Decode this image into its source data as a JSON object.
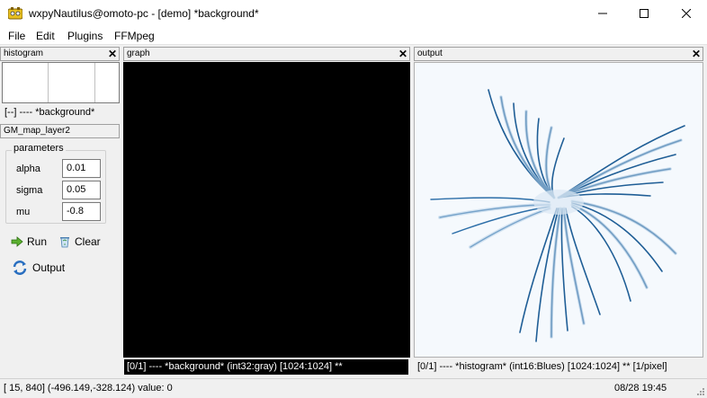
{
  "window": {
    "title": "wxpyNautilus@omoto-pc - [demo] *background*",
    "app_icon": "nautilus-app-icon",
    "controls": [
      "minimize-icon",
      "maximize-icon",
      "close-icon"
    ]
  },
  "menu": {
    "items": [
      {
        "label": "File"
      },
      {
        "label": "Edit"
      },
      {
        "label": "Plugins"
      },
      {
        "label": "FFMpeg"
      }
    ]
  },
  "histogram_pane": {
    "title": "histogram",
    "close": "✕",
    "status": "[--] ---- *background*"
  },
  "plugin_pane": {
    "title": "GM_map_layer2",
    "group_label": "parameters",
    "params": [
      {
        "label": "alpha",
        "value": "0.01"
      },
      {
        "label": "sigma",
        "value": "0.05"
      },
      {
        "label": "mu",
        "value": "-0.8"
      }
    ],
    "run_label": "Run",
    "clear_label": "Clear",
    "output_label": "Output"
  },
  "graph_pane": {
    "title": "graph",
    "close": "✕",
    "status": "[0/1] ---- *background* (int32:gray) [1024:1024] **",
    "point_color": "#ff0000",
    "background": "#000000"
  },
  "output_pane": {
    "title": "output",
    "close": "✕",
    "status": "[0/1] ---- *histogram* (int16:Blues) [1024:1024] ** [1/pixel]",
    "colormap": "Blues"
  },
  "statusbar": {
    "coords": "[  15, 840] (-496.149,-328.124) value: 0",
    "datetime": "08/28 19:45"
  }
}
